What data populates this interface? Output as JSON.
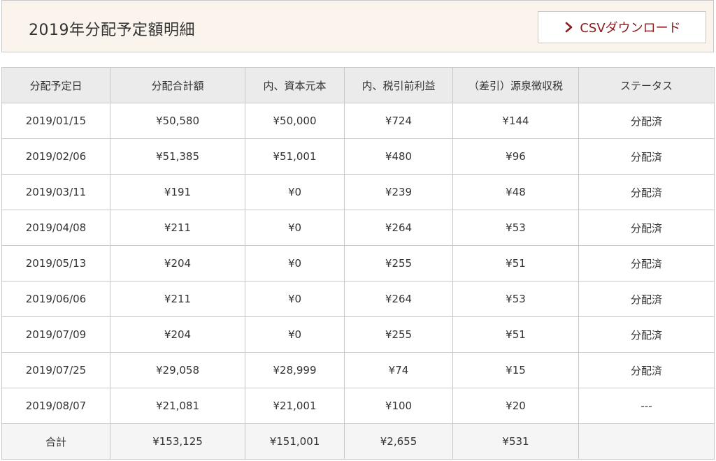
{
  "header": {
    "title": "2019年分配予定額明細",
    "csv_button_label": "CSVダウンロード",
    "csv_icon": "chevron-right-icon",
    "accent_color": "#8c1c1c",
    "background_color": "#fbf4ec"
  },
  "table": {
    "columns": [
      "分配予定日",
      "分配合計額",
      "内、資本元本",
      "内、税引前利益",
      "（差引）源泉徴収税",
      "ステータス"
    ],
    "rows": [
      [
        "2019/01/15",
        "¥50,580",
        "¥50,000",
        "¥724",
        "¥144",
        "分配済"
      ],
      [
        "2019/02/06",
        "¥51,385",
        "¥51,001",
        "¥480",
        "¥96",
        "分配済"
      ],
      [
        "2019/03/11",
        "¥191",
        "¥0",
        "¥239",
        "¥48",
        "分配済"
      ],
      [
        "2019/04/08",
        "¥211",
        "¥0",
        "¥264",
        "¥53",
        "分配済"
      ],
      [
        "2019/05/13",
        "¥204",
        "¥0",
        "¥255",
        "¥51",
        "分配済"
      ],
      [
        "2019/06/06",
        "¥211",
        "¥0",
        "¥264",
        "¥53",
        "分配済"
      ],
      [
        "2019/07/09",
        "¥204",
        "¥0",
        "¥255",
        "¥51",
        "分配済"
      ],
      [
        "2019/07/25",
        "¥29,058",
        "¥28,999",
        "¥74",
        "¥15",
        "分配済"
      ],
      [
        "2019/08/07",
        "¥21,081",
        "¥21,001",
        "¥100",
        "¥20",
        "---"
      ]
    ],
    "totals": [
      "合計",
      "¥153,125",
      "¥151,001",
      "¥2,655",
      "¥531",
      ""
    ]
  }
}
